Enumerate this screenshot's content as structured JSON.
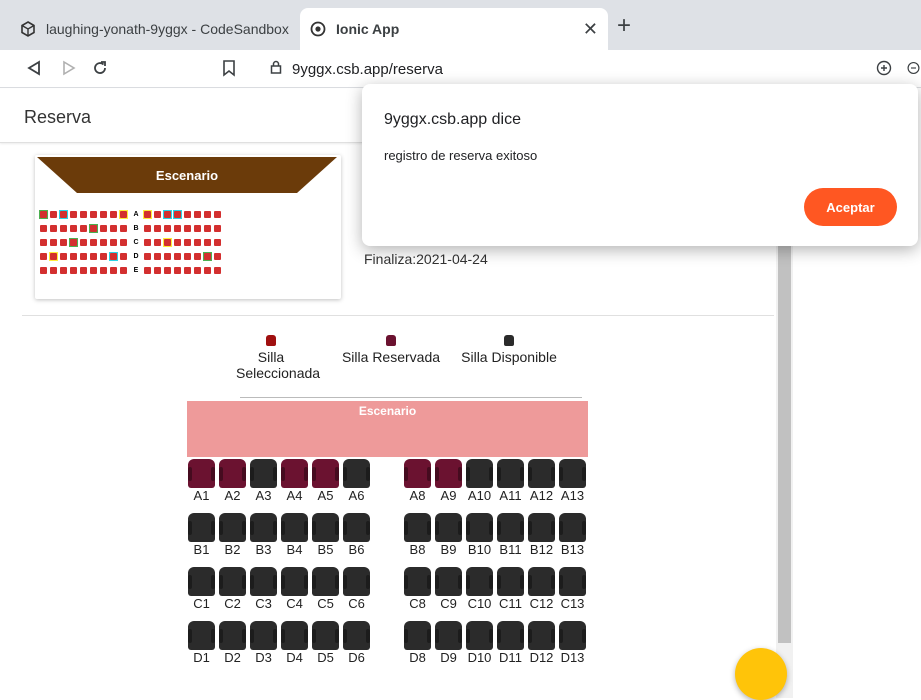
{
  "browser": {
    "tabs": [
      {
        "title": "laughing-yonath-9yggx - CodeSandbox",
        "active": false,
        "icon": "codesandbox-icon"
      },
      {
        "title": "Ionic App",
        "active": true,
        "icon": "ionic-icon"
      }
    ],
    "url": "9yggx.csb.app/reserva"
  },
  "app": {
    "title": "Reserva",
    "card": {
      "stage_label": "Escenario",
      "row_letters": [
        "A",
        "B",
        "C",
        "D",
        "E"
      ]
    },
    "finaliza": "Finaliza:2021-04-24"
  },
  "legend": [
    {
      "label": "Silla Seleccionada",
      "color": "#a01010"
    },
    {
      "label": "Silla Reservada",
      "color": "#6b1230"
    },
    {
      "label": "Silla Disponible",
      "color": "#2b2b2b"
    }
  ],
  "stage_label": "Escenario",
  "seat_colors": {
    "reserved": "#6b1230",
    "available": "#2b2b2b"
  },
  "seat_rows": [
    {
      "row": "A",
      "seats": [
        {
          "label": "A1",
          "status": "reserved"
        },
        {
          "label": "A2",
          "status": "reserved"
        },
        {
          "label": "A3",
          "status": "available"
        },
        {
          "label": "A4",
          "status": "reserved"
        },
        {
          "label": "A5",
          "status": "reserved"
        },
        {
          "label": "A6",
          "status": "available"
        },
        {
          "label": "A8",
          "status": "reserved"
        },
        {
          "label": "A9",
          "status": "reserved"
        },
        {
          "label": "A10",
          "status": "available"
        },
        {
          "label": "A11",
          "status": "available"
        },
        {
          "label": "A12",
          "status": "available"
        },
        {
          "label": "A13",
          "status": "available"
        }
      ]
    },
    {
      "row": "B",
      "seats": [
        {
          "label": "B1",
          "status": "available"
        },
        {
          "label": "B2",
          "status": "available"
        },
        {
          "label": "B3",
          "status": "available"
        },
        {
          "label": "B4",
          "status": "available"
        },
        {
          "label": "B5",
          "status": "available"
        },
        {
          "label": "B6",
          "status": "available"
        },
        {
          "label": "B8",
          "status": "available"
        },
        {
          "label": "B9",
          "status": "available"
        },
        {
          "label": "B10",
          "status": "available"
        },
        {
          "label": "B11",
          "status": "available"
        },
        {
          "label": "B12",
          "status": "available"
        },
        {
          "label": "B13",
          "status": "available"
        }
      ]
    },
    {
      "row": "C",
      "seats": [
        {
          "label": "C1",
          "status": "available"
        },
        {
          "label": "C2",
          "status": "available"
        },
        {
          "label": "C3",
          "status": "available"
        },
        {
          "label": "C4",
          "status": "available"
        },
        {
          "label": "C5",
          "status": "available"
        },
        {
          "label": "C6",
          "status": "available"
        },
        {
          "label": "C8",
          "status": "available"
        },
        {
          "label": "C9",
          "status": "available"
        },
        {
          "label": "C10",
          "status": "available"
        },
        {
          "label": "C11",
          "status": "available"
        },
        {
          "label": "C12",
          "status": "available"
        },
        {
          "label": "C13",
          "status": "available"
        }
      ]
    },
    {
      "row": "D",
      "seats": [
        {
          "label": "D1",
          "status": "available"
        },
        {
          "label": "D2",
          "status": "available"
        },
        {
          "label": "D3",
          "status": "available"
        },
        {
          "label": "D4",
          "status": "available"
        },
        {
          "label": "D5",
          "status": "available"
        },
        {
          "label": "D6",
          "status": "available"
        },
        {
          "label": "D8",
          "status": "available"
        },
        {
          "label": "D9",
          "status": "available"
        },
        {
          "label": "D10",
          "status": "available"
        },
        {
          "label": "D11",
          "status": "available"
        },
        {
          "label": "D12",
          "status": "available"
        },
        {
          "label": "D13",
          "status": "available"
        }
      ]
    }
  ],
  "alert": {
    "title": "9yggx.csb.app dice",
    "message": "registro de reserva exitoso",
    "button": "Aceptar",
    "button_color": "#ff5722"
  },
  "fab_color": "#ffc409"
}
